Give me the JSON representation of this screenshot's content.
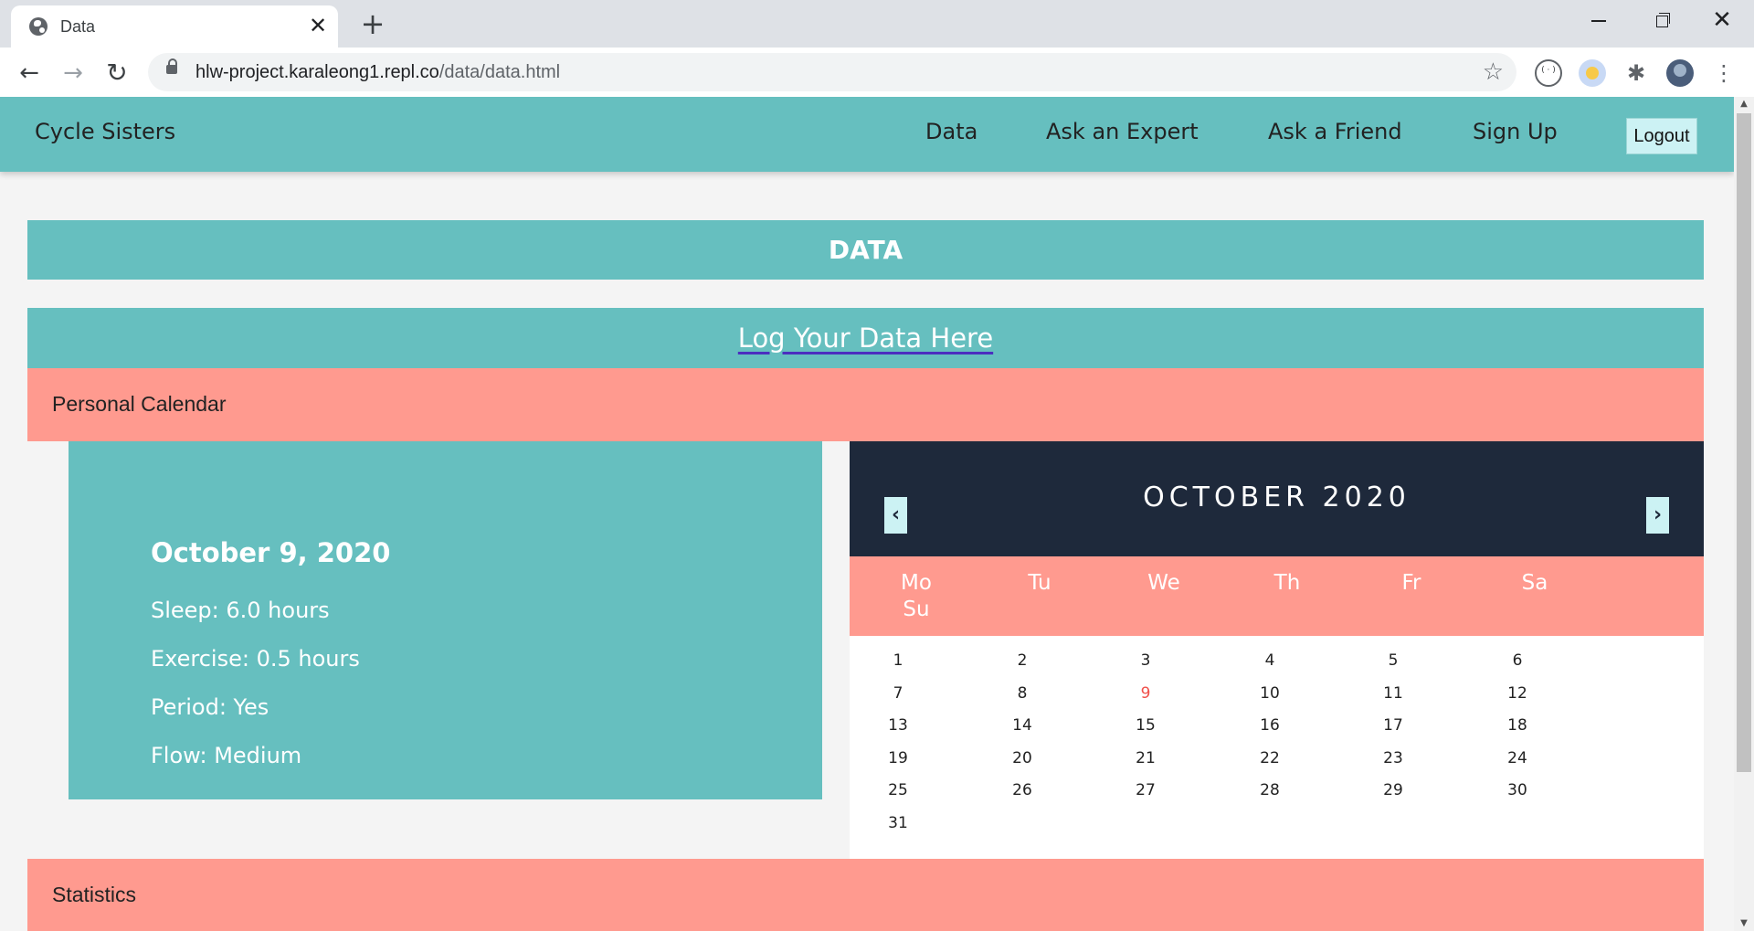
{
  "browser": {
    "tab_title": "Data",
    "tab_close": "✕",
    "new_tab": "+",
    "url_host": "hlw-project.karaleong1.repl.co",
    "url_path": "/data/data.html",
    "back": "←",
    "forward": "→",
    "reload": "↻",
    "star": "☆",
    "window_close": "✕",
    "menu": "⋮",
    "extensions": "✱"
  },
  "nav": {
    "brand": "Cycle Sisters",
    "links": [
      "Data",
      "Ask an Expert",
      "Ask a Friend",
      "Sign Up"
    ],
    "logout": "Logout"
  },
  "page": {
    "heading": "DATA",
    "log_link": "Log Your Data Here",
    "calendar_section": "Personal Calendar",
    "stats_section": "Statistics"
  },
  "day_card": {
    "date": "October 9, 2020",
    "sleep": "Sleep: 6.0 hours",
    "exercise": "Exercise: 0.5 hours",
    "period": "Period: Yes",
    "flow": "Flow: Medium"
  },
  "calendar": {
    "title": "OCTOBER 2020",
    "prev": "‹",
    "next": "›",
    "weekdays": [
      "Mo",
      "Tu",
      "We",
      "Th",
      "Fr",
      "Sa",
      "Su"
    ],
    "days": [
      "1",
      "2",
      "3",
      "4",
      "5",
      "6",
      "7",
      "8",
      "9",
      "10",
      "11",
      "12",
      "13",
      "14",
      "15",
      "16",
      "17",
      "18",
      "19",
      "20",
      "21",
      "22",
      "23",
      "24",
      "25",
      "26",
      "27",
      "28",
      "29",
      "30",
      "31"
    ],
    "selected_day": "9",
    "colors": {
      "header": "#1e293b",
      "weekday_bar": "#ff9a8f",
      "selected": "#f0504a"
    }
  },
  "colors": {
    "teal": "#66bfbf",
    "salmon": "#ff9a8f",
    "light_teal": "#ccf2f4"
  }
}
